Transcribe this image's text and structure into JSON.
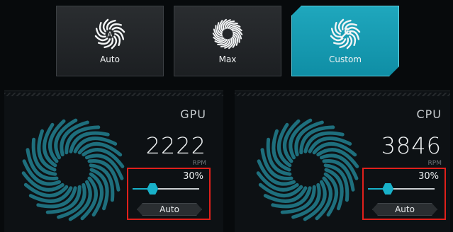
{
  "modes": [
    {
      "label": "Auto",
      "icon": "fan-auto-icon"
    },
    {
      "label": "Max",
      "icon": "fan-max-icon"
    },
    {
      "label": "Custom",
      "icon": "fan-custom-icon"
    }
  ],
  "active_mode": "Custom",
  "colors": {
    "accent": "#18b1c9",
    "highlight_box": "#e0201b"
  },
  "fans": {
    "gpu": {
      "name": "GPU",
      "rpm": "2222",
      "rpm_unit": "RPM",
      "percent": "30%",
      "percent_value": 30,
      "auto_label": "Auto"
    },
    "cpu": {
      "name": "CPU",
      "rpm": "3846",
      "rpm_unit": "RPM",
      "percent": "30%",
      "percent_value": 30,
      "auto_label": "Auto"
    }
  }
}
